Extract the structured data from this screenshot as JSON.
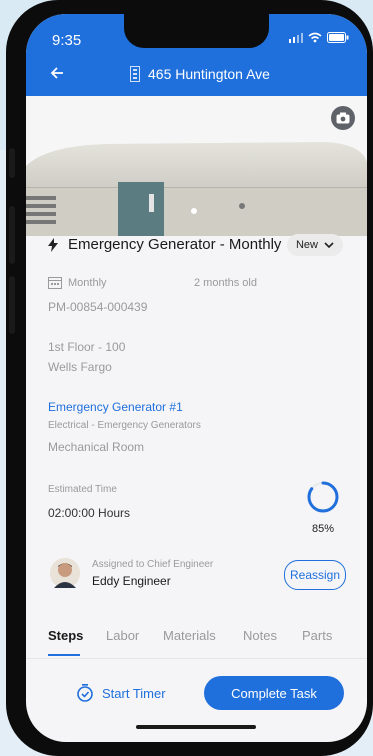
{
  "status": {
    "time": "9:35"
  },
  "header": {
    "address": "465 Huntington Ave"
  },
  "task": {
    "title": "Emergency Generator - Monthly",
    "status": "New",
    "frequency": "Monthly",
    "age": "2 months old",
    "id": "PM-00854-000439",
    "floor": "1st Floor - 100",
    "tenant": "Wells Fargo",
    "asset_name": "Emergency Generator #1",
    "asset_category": "Electrical - Emergency Generators",
    "asset_location": "Mechanical Room",
    "estimated_time_label": "Estimated Time",
    "estimated_time": "02:00:00 Hours",
    "progress_label": "85%",
    "progress_value": 0.85
  },
  "assignment": {
    "label": "Assigned to Chief Engineer",
    "name": "Eddy Engineer",
    "reassign": "Reassign"
  },
  "tabs": [
    {
      "label": "Steps"
    },
    {
      "label": "Labor"
    },
    {
      "label": "Materials"
    },
    {
      "label": "Notes"
    },
    {
      "label": "Parts"
    }
  ],
  "footer": {
    "start_timer": "Start Timer",
    "complete_task": "Complete Task"
  },
  "colors": {
    "accent": "#1f6fdc"
  }
}
